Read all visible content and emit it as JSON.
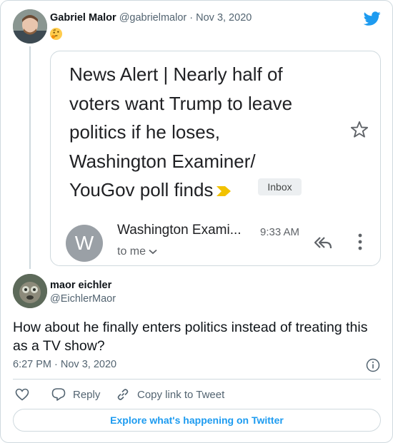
{
  "parent_tweet": {
    "author_name": "Gabriel Malor",
    "author_handle": "@gabrielmalor",
    "separator": "·",
    "date": "Nov 3, 2020",
    "emoji": "thinking-face-emoji"
  },
  "email_embed": {
    "subject": "News Alert | Nearly half of voters want Trump to leave politics if he loses, Washington Examiner/ YouGov poll finds",
    "label": "Inbox",
    "sender_initial": "W",
    "sender_name": "Washington Exami...",
    "time": "9:33 AM",
    "recipient": "to me"
  },
  "reply_tweet": {
    "author_name": "maor eichler",
    "author_handle": "@EichlerMaor",
    "text": "How about he finally enters politics instead of treating this as a TV show?",
    "timestamp": "6:27 PM · Nov 3, 2020"
  },
  "actions": {
    "reply_label": "Reply",
    "copy_link_label": "Copy link to Tweet"
  },
  "explore_label": "Explore what's happening on Twitter",
  "colors": {
    "twitter_blue": "#1d9bf0",
    "text": "#0f1419",
    "muted": "#536471",
    "border": "#cfd9de",
    "gmail_arrow": "#f2c200"
  }
}
